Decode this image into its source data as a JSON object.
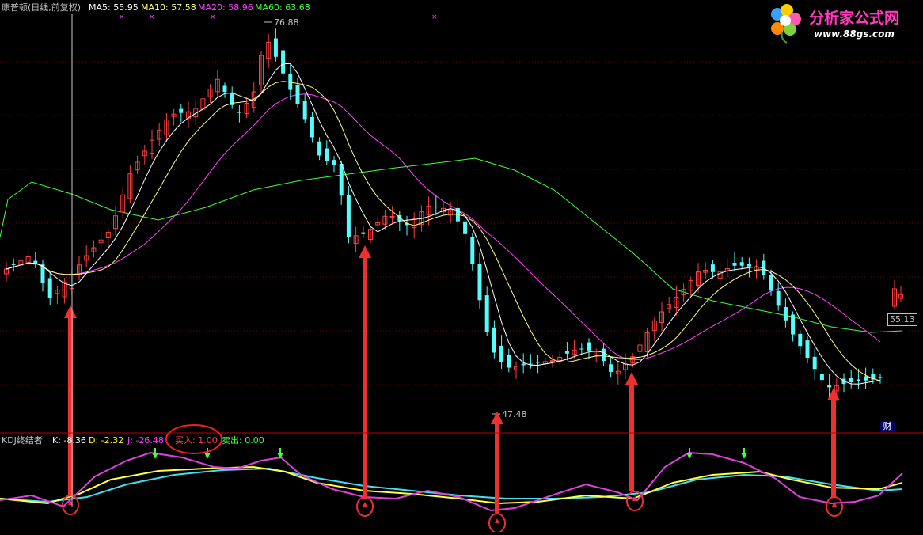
{
  "main_header": {
    "title": "康普顿(日线,前复权)",
    "ma5": "MA5: 55.95",
    "ma10": "MA10: 57.58",
    "ma20": "MA20: 58.96",
    "ma60": "MA60: 63.68"
  },
  "kdj_header": {
    "title": "KDJ终结者",
    "k": "K: -8.36",
    "d": "D: -2.32",
    "j": "J: -26.48",
    "buy": "买入: 1.00",
    "sell": "卖出: 0.00"
  },
  "price_labels": {
    "high": "76.88",
    "low": "47.48",
    "last": "55.13",
    "cai": "财"
  },
  "logo": {
    "text": "分析家公式网",
    "url": "www.88gs.com"
  },
  "colors": {
    "bg": "#000000",
    "up": "#ff4040",
    "down": "#54fcfc",
    "ma5": "#ffffff",
    "ma10": "#ffff80",
    "ma20": "#ff40ff",
    "ma60": "#40ff40",
    "arrow": "#ee3030",
    "grid": "#800000"
  },
  "chart_data": {
    "type": "candlestick",
    "price_axis": [
      47.48,
      76.88
    ],
    "candles_count": 121,
    "kdj": {
      "k": -8.36,
      "d": -2.32,
      "j": -26.48,
      "buy": 1.0,
      "sell": 0.0
    }
  }
}
